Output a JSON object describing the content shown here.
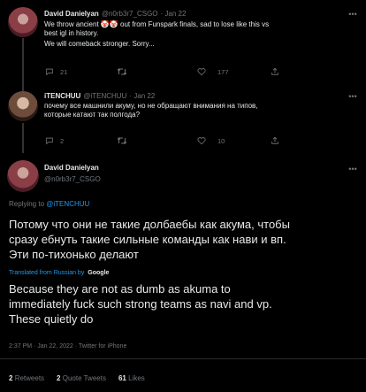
{
  "tweet1": {
    "name": "David Danielyan",
    "handle": "@n0rb3r7_CSGO",
    "date": "· Jan 22",
    "text_line1": "We throw ancient 🤡🤡 out from Funspark finals, sad to lose like this vs",
    "text_line2": "best igl in history.",
    "text_line3": "We will comeback stronger. Sorry...",
    "replies": "21",
    "retweets": "",
    "likes": "177"
  },
  "tweet2": {
    "name": "iTENCHUU",
    "handle": "@iTENCHUU",
    "date": "· Jan 22",
    "text_line1": "почему все машнили акуму, но не обращают внимания на типов,",
    "text_line2": "которые катают так полгода?",
    "replies": "2",
    "likes": "10"
  },
  "main": {
    "name": "David Danielyan",
    "handle": "@n0rb3r7_CSGO",
    "replying_prefix": "Replying to",
    "replying_to": "@iTENCHUU",
    "original_line1": "Потому что они не такие долбаебы как акума, чтобы",
    "original_line2": "сразу ебнуть такие сильные команды как нави и вп.",
    "original_line3": "Эти по-тихонько делают",
    "translated_prefix": "Translated from Russian by",
    "translated_by": "Google",
    "translation_line1": "Because they are not as dumb as akuma to",
    "translation_line2": "immediately fuck such strong teams as navi and vp.",
    "translation_line3": "These quietly do",
    "time": "2:37 PM · Jan 22, 2022 · Twitter for iPhone",
    "stats": [
      {
        "count": "2",
        "label": "Retweets"
      },
      {
        "count": "2",
        "label": "Quote Tweets"
      },
      {
        "count": "61",
        "label": "Likes"
      }
    ]
  },
  "icons": {
    "reply": "reply-icon",
    "retweet": "retweet-icon",
    "like": "heart-icon",
    "share": "share-icon",
    "more": "more-icon"
  },
  "colors": {
    "background": "#000000",
    "text": "#e7e9ea",
    "muted": "#71767b",
    "link": "#1d9bf0"
  }
}
